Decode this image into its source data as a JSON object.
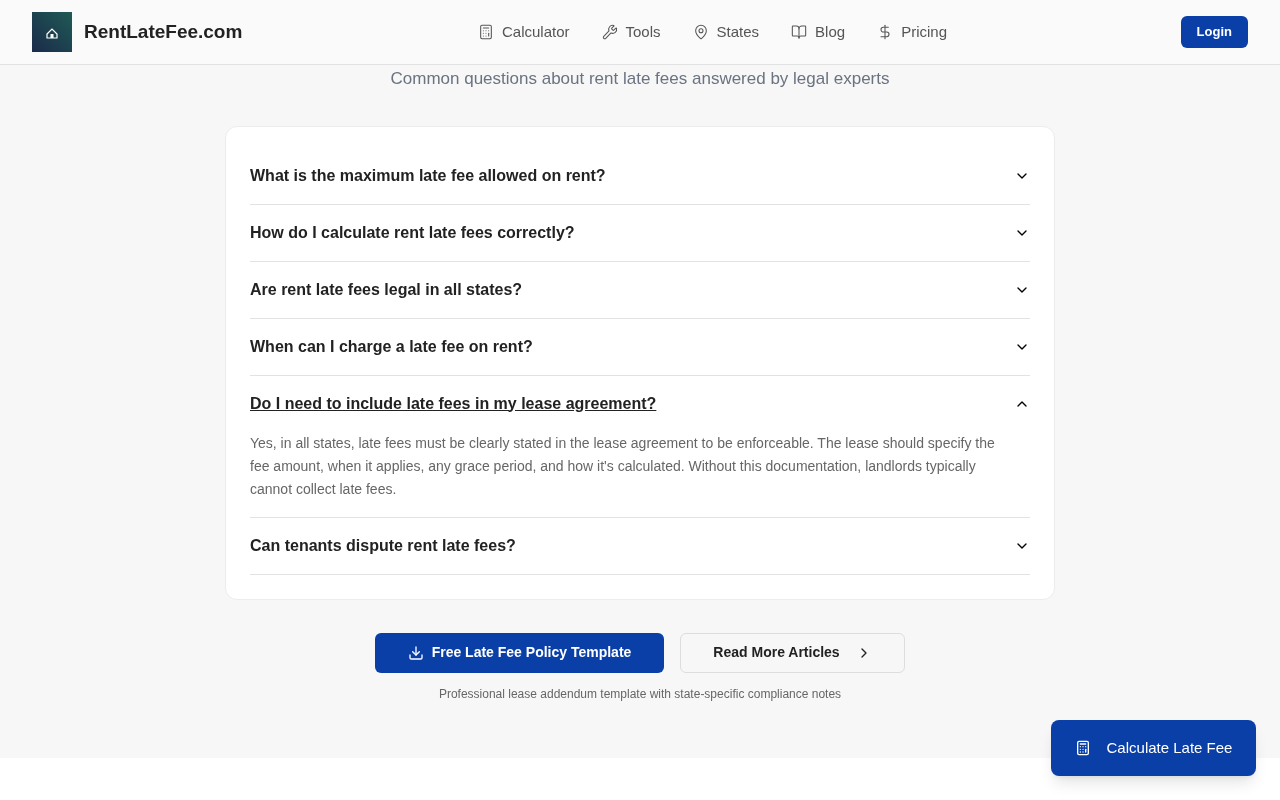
{
  "header": {
    "brand": "RentLateFee.com",
    "nav": [
      {
        "kind": "calculator",
        "label": "Calculator"
      },
      {
        "kind": "tools",
        "label": "Tools"
      },
      {
        "kind": "states",
        "label": "States"
      },
      {
        "kind": "blog",
        "label": "Blog"
      },
      {
        "kind": "pricing",
        "label": "Pricing"
      }
    ],
    "login": "Login"
  },
  "subtitle": "Common questions about rent late fees answered by legal experts",
  "faq": [
    {
      "question": "What is the maximum late fee allowed on rent?",
      "expanded": false
    },
    {
      "question": "How do I calculate rent late fees correctly?",
      "expanded": false
    },
    {
      "question": "Are rent late fees legal in all states?",
      "expanded": false
    },
    {
      "question": "When can I charge a late fee on rent?",
      "expanded": false
    },
    {
      "question": "Do I need to include late fees in my lease agreement?",
      "expanded": true,
      "answer": "Yes, in all states, late fees must be clearly stated in the lease agreement to be enforceable. The lease should specify the fee amount, when it applies, any grace period, and how it's calculated. Without this documentation, landlords typically cannot collect late fees."
    },
    {
      "question": "Can tenants dispute rent late fees?",
      "expanded": false
    }
  ],
  "actions": {
    "primary": "Free Late Fee Policy Template",
    "secondary": "Read More Articles",
    "note": "Professional lease addendum template with state-specific compliance notes"
  },
  "floating_button": "Calculate Late Fee"
}
